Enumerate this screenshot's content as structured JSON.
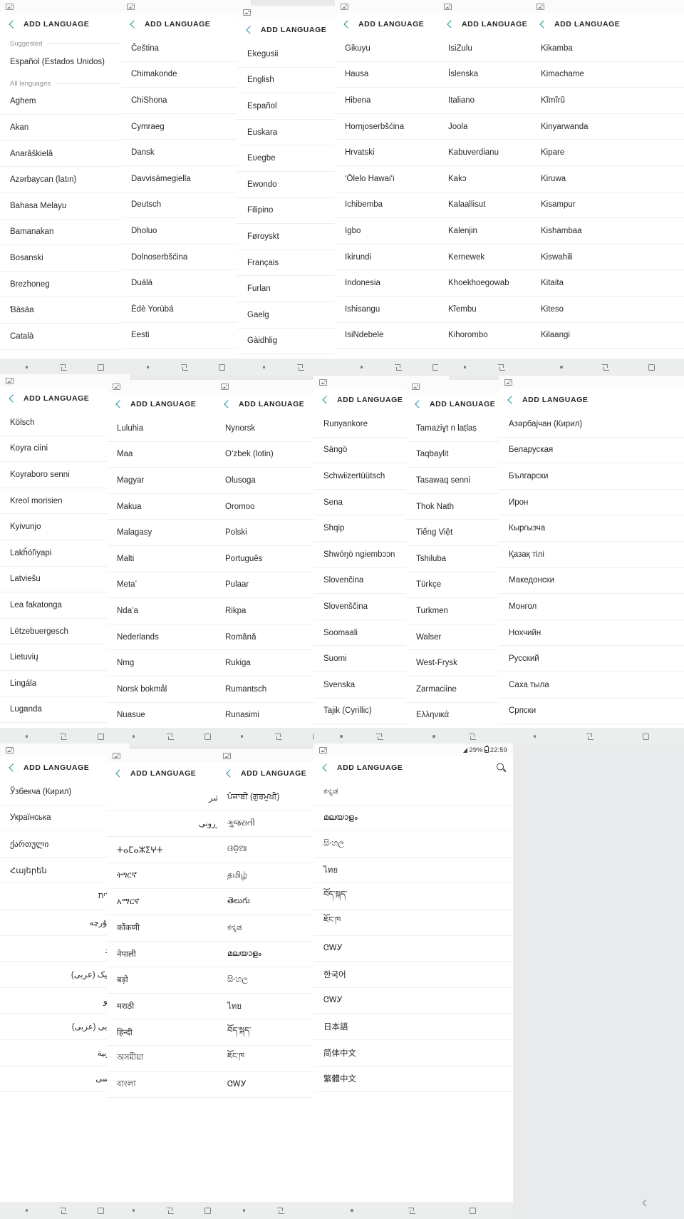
{
  "app": {
    "title": "ADD LANGUAGE",
    "back_icon": "back-chevron-icon",
    "search_icon": "search-icon",
    "gallery_icon": "gallery-image-icon",
    "accent_color": "#1a8a9a",
    "text_color": "#26282c",
    "muted_color": "#8f9296",
    "panel_background": "#ffffff",
    "collage_background": "#e9eaec",
    "navbar_background": "#eceded"
  },
  "status_bar": {
    "battery_percent": "29%",
    "time": "22:59",
    "signal_icon": "signal-triangle-icon",
    "battery_icon": "battery-icon"
  },
  "nav_bar": {
    "recents_icon": "recents-dot-icon",
    "home_icon": "home-back-icon",
    "square_icon": "recents-square-icon",
    "back_chevron_icon": "nav-back-chevron-icon",
    "corner_icon": "nav-corner-icon"
  },
  "sections": {
    "suggested_label": "Suggested",
    "all_languages_label": "All languages"
  },
  "panels": [
    {
      "id": "panel-1",
      "has_suggested": true,
      "suggested": [
        "Español (Estados Unidos)"
      ],
      "languages": [
        "Aghem",
        "Akan",
        "Anarâškielâ",
        "Azərbaycan (latın)",
        "Bahasa Melayu",
        "Bamanakan",
        "Bosanski",
        "Brezhoneg",
        "Ɓàsàa",
        "Català"
      ]
    },
    {
      "id": "panel-2",
      "has_suggested": false,
      "languages": [
        "Čeština",
        "Chimakonde",
        "ChiShona",
        "Cymraeg",
        "Dansk",
        "Davvisámegiella",
        "Deutsch",
        "Dholuo",
        "Dolnoserbšćina",
        "Duálá",
        "Èdè Yorùbá",
        "Eesti"
      ]
    },
    {
      "id": "panel-3",
      "has_suggested": false,
      "languages": [
        "Ekegusii",
        "English",
        "Español",
        "Euskara",
        "Eʋegbe",
        "Ewondo",
        "Filipino",
        "Føroyskt",
        "Français",
        "Furlan",
        "Gaelg",
        "Gàidhlig"
      ]
    },
    {
      "id": "panel-4",
      "has_suggested": false,
      "languages": [
        "Gikuyu",
        "Hausa",
        "Hibena",
        "Hornjoserbšćina",
        "Hrvatski",
        "ʻŌlelo Hawaiʻi",
        "Ichibemba",
        "Igbo",
        "Ikirundi",
        "Indonesia",
        "Ishisangu",
        "IsiNdebele"
      ]
    },
    {
      "id": "panel-5",
      "has_suggested": false,
      "languages": [
        "IsiZulu",
        "Íslenska",
        "Italiano",
        "Joola",
        "Kabuverdianu",
        "Kakɔ",
        "Kalaallisut",
        "Kalenjin",
        "Kernewek",
        "Khoekhoegowab",
        "Kĩembu",
        "Kihorombo"
      ]
    },
    {
      "id": "panel-6",
      "has_suggested": false,
      "languages": [
        "Kikamba",
        "Kimachame",
        "Kĩmĩrũ",
        "Kinyarwanda",
        "Kipare",
        "Kiruwa",
        "Kisampur",
        "Kishambaa",
        "Kiswahili",
        "Kitaita",
        "Kiteso",
        "Kɨlaangi"
      ]
    },
    {
      "id": "panel-7",
      "has_suggested": false,
      "languages": [
        "Kölsch",
        "Koyra ciini",
        "Koyraboro senni",
        "Kreol morisien",
        "Kyivunjo",
        "Lakȟóľiyapi",
        "Latviešu",
        "Lea fakatonga",
        "Lëtzebuergesch",
        "Lietuvių",
        "Lingála",
        "Luganda"
      ]
    },
    {
      "id": "panel-8",
      "has_suggested": false,
      "languages": [
        "Luluhia",
        "Maa",
        "Magyar",
        "Makua",
        "Malagasy",
        "Malti",
        "Metaʼ",
        "Ndaʼa",
        "Nederlands",
        "Nmg",
        "Norsk bokmål",
        "Nuasue"
      ]
    },
    {
      "id": "panel-9",
      "has_suggested": false,
      "languages": [
        "Nynorsk",
        "Oʻzbek (lotin)",
        "Olusoga",
        "Oromoo",
        "Polski",
        "Português",
        "Pulaar",
        "Rikpa",
        "Română",
        "Rukiga",
        "Rumantsch",
        "Runasimi"
      ]
    },
    {
      "id": "panel-10",
      "has_suggested": false,
      "languages": [
        "Runyankore",
        "Sängö",
        "Schwiizertüütsch",
        "Sena",
        "Shqip",
        "Shwóŋò ngiembɔɔn",
        "Slovenčina",
        "Slovenščina",
        "Soomaali",
        "Suomi",
        "Svenska",
        "Tajik (Cyrillic)"
      ]
    },
    {
      "id": "panel-11",
      "has_suggested": false,
      "languages": [
        "Tamaziɣt n laṭlaṣ",
        "Taqbaylit",
        "Tasawaq senni",
        "Thok Nath",
        "Tiếng Việt",
        "Tshiluba",
        "Türkçe",
        "Turkmen",
        "Walser",
        "West-Frysk",
        "Zarmaciine",
        "Ελληνικά"
      ]
    },
    {
      "id": "panel-12",
      "has_suggested": false,
      "languages": [
        "Азәрбајчан (Кирил)",
        "Беларуская",
        "Български",
        "Ирон",
        "Кыргызча",
        "Қазақ тілі",
        "Македонски",
        "Монгол",
        "Нохчийн",
        "Русский",
        "Саха тыла",
        "Српски"
      ]
    },
    {
      "id": "panel-13",
      "has_suggested": false,
      "rtl_from": 4,
      "languages": [
        "Ўзбекча (Кирил)",
        "Українська",
        "ქართული",
        "Հայերեն",
        "עברית",
        "ئۇيغۇرچە",
        "اردو",
        "اوزبیک (عربی)",
        "پښتو",
        "پنجابی (عربی)",
        "العربية",
        "فارسی"
      ]
    },
    {
      "id": "panel-14",
      "has_suggested": false,
      "rtl_from": 0,
      "rtl_count": 2,
      "languages": [
        "كأشر",
        "مازرونی",
        "ⵜⴰⵎⴰⵣⵉⵖⵜ",
        "ትግርኛ",
        "አማርኛ",
        "कोंकणी",
        "नेपाली",
        "बड़ो",
        "मराठी",
        "हिन्दी",
        "অসমীয়া",
        "বাংলা"
      ]
    },
    {
      "id": "panel-15",
      "has_suggested": false,
      "languages": [
        "ਪੰਜਾਬੀ (ਗੁਰਮੁਖੀ)",
        "ગુજરાતી",
        "ଓଡ଼ିଆ",
        "தமிழ்",
        "తెలుగు",
        "ಕನ್ನಡ",
        "മലയാളം",
        "සිංහල",
        "ไทย",
        "བོད་སྐད་",
        "ཇོང་ཁ",
        "ᏣᎳᎩ"
      ]
    },
    {
      "id": "panel-16",
      "has_suggested": false,
      "has_search": true,
      "has_status_info": true,
      "languages": [
        "ಕನ್ನಡ",
        "മലയാളം",
        "සිංහල",
        "ไทย",
        "བོད་སྐད་",
        "ཇོང་ཁ",
        "ᏣᎳᎩ",
        "한국어",
        "ᏣᎳᎩ",
        "日本語",
        "简体中文",
        "繁體中文"
      ]
    }
  ]
}
